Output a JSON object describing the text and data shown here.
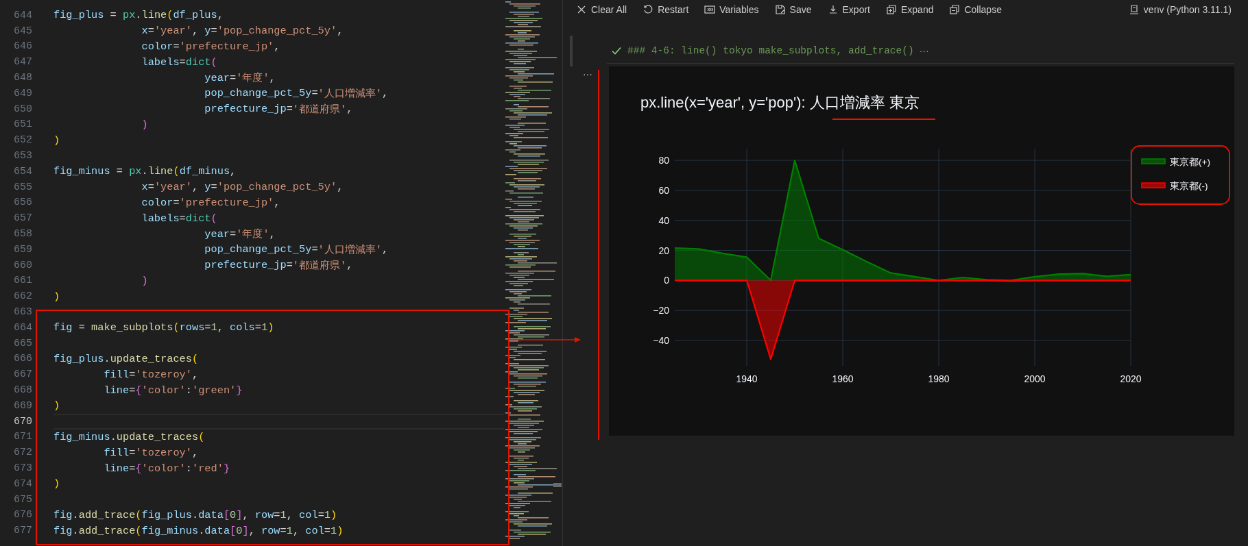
{
  "editor": {
    "lines": [
      {
        "number": "644",
        "current": false,
        "tokens": [
          {
            "kind": "var",
            "text": "fig_plus"
          },
          {
            "kind": "op",
            "text": " = "
          },
          {
            "kind": "mod",
            "text": "px"
          },
          {
            "kind": "op",
            "text": "."
          },
          {
            "kind": "fn",
            "text": "line"
          },
          {
            "kind": "b1",
            "text": "("
          },
          {
            "kind": "var",
            "text": "df_plus"
          },
          {
            "kind": "op",
            "text": ","
          }
        ]
      },
      {
        "number": "645",
        "current": false,
        "tokens": [
          {
            "kind": "var",
            "text": "              x"
          },
          {
            "kind": "op",
            "text": "="
          },
          {
            "kind": "str",
            "text": "'year'"
          },
          {
            "kind": "op",
            "text": ", "
          },
          {
            "kind": "var",
            "text": "y"
          },
          {
            "kind": "op",
            "text": "="
          },
          {
            "kind": "str",
            "text": "'pop_change_pct_5y'"
          },
          {
            "kind": "op",
            "text": ","
          }
        ]
      },
      {
        "number": "646",
        "current": false,
        "tokens": [
          {
            "kind": "var",
            "text": "              color"
          },
          {
            "kind": "op",
            "text": "="
          },
          {
            "kind": "str",
            "text": "'prefecture_jp'"
          },
          {
            "kind": "op",
            "text": ","
          }
        ]
      },
      {
        "number": "647",
        "current": false,
        "tokens": [
          {
            "kind": "var",
            "text": "              labels"
          },
          {
            "kind": "op",
            "text": "="
          },
          {
            "kind": "mod",
            "text": "dict"
          },
          {
            "kind": "b2",
            "text": "("
          }
        ]
      },
      {
        "number": "648",
        "current": false,
        "tokens": [
          {
            "kind": "var",
            "text": "                        year"
          },
          {
            "kind": "op",
            "text": "="
          },
          {
            "kind": "str",
            "text": "'年度'"
          },
          {
            "kind": "op",
            "text": ","
          }
        ]
      },
      {
        "number": "649",
        "current": false,
        "tokens": [
          {
            "kind": "var",
            "text": "                        pop_change_pct_5y"
          },
          {
            "kind": "op",
            "text": "="
          },
          {
            "kind": "str",
            "text": "'人口増減率'"
          },
          {
            "kind": "op",
            "text": ","
          }
        ]
      },
      {
        "number": "650",
        "current": false,
        "tokens": [
          {
            "kind": "var",
            "text": "                        prefecture_jp"
          },
          {
            "kind": "op",
            "text": "="
          },
          {
            "kind": "str",
            "text": "'都道府県'"
          },
          {
            "kind": "op",
            "text": ","
          }
        ]
      },
      {
        "number": "651",
        "current": false,
        "tokens": [
          {
            "kind": "b2",
            "text": "              )"
          }
        ]
      },
      {
        "number": "652",
        "current": false,
        "tokens": [
          {
            "kind": "b1",
            "text": ")"
          }
        ]
      },
      {
        "number": "653",
        "current": false
      },
      {
        "number": "654",
        "current": false,
        "tokens": [
          {
            "kind": "var",
            "text": "fig_minus"
          },
          {
            "kind": "op",
            "text": " = "
          },
          {
            "kind": "mod",
            "text": "px"
          },
          {
            "kind": "op",
            "text": "."
          },
          {
            "kind": "fn",
            "text": "line"
          },
          {
            "kind": "b1",
            "text": "("
          },
          {
            "kind": "var",
            "text": "df_minus"
          },
          {
            "kind": "op",
            "text": ","
          }
        ]
      },
      {
        "number": "655",
        "current": false,
        "tokens": [
          {
            "kind": "var",
            "text": "              x"
          },
          {
            "kind": "op",
            "text": "="
          },
          {
            "kind": "str",
            "text": "'year'"
          },
          {
            "kind": "op",
            "text": ", "
          },
          {
            "kind": "var",
            "text": "y"
          },
          {
            "kind": "op",
            "text": "="
          },
          {
            "kind": "str",
            "text": "'pop_change_pct_5y'"
          },
          {
            "kind": "op",
            "text": ","
          }
        ]
      },
      {
        "number": "656",
        "current": false,
        "tokens": [
          {
            "kind": "var",
            "text": "              color"
          },
          {
            "kind": "op",
            "text": "="
          },
          {
            "kind": "str",
            "text": "'prefecture_jp'"
          },
          {
            "kind": "op",
            "text": ","
          }
        ]
      },
      {
        "number": "657",
        "current": false,
        "tokens": [
          {
            "kind": "var",
            "text": "              labels"
          },
          {
            "kind": "op",
            "text": "="
          },
          {
            "kind": "mod",
            "text": "dict"
          },
          {
            "kind": "b2",
            "text": "("
          }
        ]
      },
      {
        "number": "658",
        "current": false,
        "tokens": [
          {
            "kind": "var",
            "text": "                        year"
          },
          {
            "kind": "op",
            "text": "="
          },
          {
            "kind": "str",
            "text": "'年度'"
          },
          {
            "kind": "op",
            "text": ","
          }
        ]
      },
      {
        "number": "659",
        "current": false,
        "tokens": [
          {
            "kind": "var",
            "text": "                        pop_change_pct_5y"
          },
          {
            "kind": "op",
            "text": "="
          },
          {
            "kind": "str",
            "text": "'人口増減率'"
          },
          {
            "kind": "op",
            "text": ","
          }
        ]
      },
      {
        "number": "660",
        "current": false,
        "tokens": [
          {
            "kind": "var",
            "text": "                        prefecture_jp"
          },
          {
            "kind": "op",
            "text": "="
          },
          {
            "kind": "str",
            "text": "'都道府県'"
          },
          {
            "kind": "op",
            "text": ","
          }
        ]
      },
      {
        "number": "661",
        "current": false,
        "tokens": [
          {
            "kind": "b2",
            "text": "              )"
          }
        ]
      },
      {
        "number": "662",
        "current": false,
        "tokens": [
          {
            "kind": "b1",
            "text": ")"
          }
        ]
      },
      {
        "number": "663",
        "current": false
      },
      {
        "number": "664",
        "current": false,
        "tokens": [
          {
            "kind": "var",
            "text": "fig"
          },
          {
            "kind": "op",
            "text": " = "
          },
          {
            "kind": "fn",
            "text": "make_subplots"
          },
          {
            "kind": "b1",
            "text": "("
          },
          {
            "kind": "var",
            "text": "rows"
          },
          {
            "kind": "op",
            "text": "="
          },
          {
            "kind": "num",
            "text": "1"
          },
          {
            "kind": "op",
            "text": ", "
          },
          {
            "kind": "var",
            "text": "cols"
          },
          {
            "kind": "op",
            "text": "="
          },
          {
            "kind": "num",
            "text": "1"
          },
          {
            "kind": "b1",
            "text": ")"
          }
        ]
      },
      {
        "number": "665",
        "current": false
      },
      {
        "number": "666",
        "current": false,
        "tokens": [
          {
            "kind": "var",
            "text": "fig_plus"
          },
          {
            "kind": "op",
            "text": "."
          },
          {
            "kind": "fn",
            "text": "update_traces"
          },
          {
            "kind": "b1",
            "text": "("
          }
        ]
      },
      {
        "number": "667",
        "current": false,
        "tokens": [
          {
            "kind": "var",
            "text": "        fill"
          },
          {
            "kind": "op",
            "text": "="
          },
          {
            "kind": "str",
            "text": "'tozeroy'"
          },
          {
            "kind": "op",
            "text": ","
          }
        ]
      },
      {
        "number": "668",
        "current": false,
        "tokens": [
          {
            "kind": "var",
            "text": "        line"
          },
          {
            "kind": "op",
            "text": "="
          },
          {
            "kind": "b2",
            "text": "{"
          },
          {
            "kind": "str",
            "text": "'color'"
          },
          {
            "kind": "op",
            "text": ":"
          },
          {
            "kind": "str",
            "text": "'green'"
          },
          {
            "kind": "b2",
            "text": "}"
          }
        ]
      },
      {
        "number": "669",
        "current": false,
        "tokens": [
          {
            "kind": "b1",
            "text": ")"
          }
        ]
      },
      {
        "number": "670",
        "current": true
      },
      {
        "number": "671",
        "current": false,
        "tokens": [
          {
            "kind": "var",
            "text": "fig_minus"
          },
          {
            "kind": "op",
            "text": "."
          },
          {
            "kind": "fn",
            "text": "update_traces"
          },
          {
            "kind": "b1",
            "text": "("
          }
        ]
      },
      {
        "number": "672",
        "current": false,
        "tokens": [
          {
            "kind": "var",
            "text": "        fill"
          },
          {
            "kind": "op",
            "text": "="
          },
          {
            "kind": "str",
            "text": "'tozeroy'"
          },
          {
            "kind": "op",
            "text": ","
          }
        ]
      },
      {
        "number": "673",
        "current": false,
        "tokens": [
          {
            "kind": "var",
            "text": "        line"
          },
          {
            "kind": "op",
            "text": "="
          },
          {
            "kind": "b2",
            "text": "{"
          },
          {
            "kind": "str",
            "text": "'color'"
          },
          {
            "kind": "op",
            "text": ":"
          },
          {
            "kind": "str",
            "text": "'red'"
          },
          {
            "kind": "b2",
            "text": "}"
          }
        ]
      },
      {
        "number": "674",
        "current": false,
        "tokens": [
          {
            "kind": "b1",
            "text": ")"
          }
        ]
      },
      {
        "number": "675",
        "current": false
      },
      {
        "number": "676",
        "current": false,
        "tokens": [
          {
            "kind": "var",
            "text": "fig"
          },
          {
            "kind": "op",
            "text": "."
          },
          {
            "kind": "fn",
            "text": "add_trace"
          },
          {
            "kind": "b1",
            "text": "("
          },
          {
            "kind": "var",
            "text": "fig_plus"
          },
          {
            "kind": "op",
            "text": "."
          },
          {
            "kind": "var",
            "text": "data"
          },
          {
            "kind": "b2",
            "text": "["
          },
          {
            "kind": "num",
            "text": "0"
          },
          {
            "kind": "b2",
            "text": "]"
          },
          {
            "kind": "op",
            "text": ", "
          },
          {
            "kind": "var",
            "text": "row"
          },
          {
            "kind": "op",
            "text": "="
          },
          {
            "kind": "num",
            "text": "1"
          },
          {
            "kind": "op",
            "text": ", "
          },
          {
            "kind": "var",
            "text": "col"
          },
          {
            "kind": "op",
            "text": "="
          },
          {
            "kind": "num",
            "text": "1"
          },
          {
            "kind": "b1",
            "text": ")"
          }
        ]
      },
      {
        "number": "677",
        "current": false,
        "tokens": [
          {
            "kind": "var",
            "text": "fig"
          },
          {
            "kind": "op",
            "text": "."
          },
          {
            "kind": "fn",
            "text": "add_trace"
          },
          {
            "kind": "b1",
            "text": "("
          },
          {
            "kind": "var",
            "text": "fig_minus"
          },
          {
            "kind": "op",
            "text": "."
          },
          {
            "kind": "var",
            "text": "data"
          },
          {
            "kind": "b2",
            "text": "["
          },
          {
            "kind": "num",
            "text": "0"
          },
          {
            "kind": "b2",
            "text": "]"
          },
          {
            "kind": "op",
            "text": ", "
          },
          {
            "kind": "var",
            "text": "row"
          },
          {
            "kind": "op",
            "text": "="
          },
          {
            "kind": "num",
            "text": "1"
          },
          {
            "kind": "op",
            "text": ", "
          },
          {
            "kind": "var",
            "text": "col"
          },
          {
            "kind": "op",
            "text": "="
          },
          {
            "kind": "num",
            "text": "1"
          },
          {
            "kind": "b1",
            "text": ")"
          }
        ]
      }
    ]
  },
  "toolbar": {
    "items": [
      {
        "kind": "clear",
        "label": "Clear All"
      },
      {
        "kind": "restart",
        "label": "Restart"
      },
      {
        "kind": "variables",
        "label": "Variables"
      },
      {
        "kind": "save",
        "label": "Save"
      },
      {
        "kind": "export",
        "label": "Export"
      },
      {
        "kind": "expand",
        "label": "Expand"
      },
      {
        "kind": "collapse",
        "label": "Collapse"
      }
    ],
    "kernel": {
      "label": "venv (Python 3.11.1)"
    }
  },
  "cell": {
    "success": true,
    "summary": "### 4-6: line() tokyo make_subplots, add_trace()",
    "more": "···"
  },
  "output": {
    "menu": "···",
    "chart_data": {
      "type": "area",
      "title": "px.line(x='year', y='pop'): 人口増減率 東京",
      "grid": true,
      "legend": true,
      "x": [
        1925,
        1930,
        1935,
        1940,
        1945,
        1950,
        1955,
        1960,
        1965,
        1970,
        1975,
        1980,
        1985,
        1990,
        1995,
        2000,
        2005,
        2010,
        2015,
        2020
      ],
      "series": [
        {
          "name": "東京都(+)",
          "color": "#008000",
          "values": [
            21.5,
            21,
            18,
            15.5,
            0,
            80,
            28,
            20.5,
            12.5,
            5,
            2.5,
            0,
            2,
            0.5,
            0,
            2.5,
            4.2,
            4.6,
            2.7,
            3.9
          ]
        },
        {
          "name": "東京都(-)",
          "color": "#ff0000",
          "values": [
            0,
            0,
            0,
            0,
            -52.5,
            0,
            0,
            0,
            0,
            0,
            0,
            -0.3,
            0,
            0,
            -0.5,
            0,
            0,
            0,
            0,
            0
          ]
        }
      ],
      "xlim": [
        1925,
        2020
      ],
      "ylim": [
        -56.9,
        87.8
      ],
      "xticks": [
        1940,
        1960,
        1980,
        2000,
        2020
      ],
      "yticks": [
        {
          "value": -40,
          "label": "−40"
        },
        {
          "value": -20,
          "label": "−20"
        },
        {
          "value": 0,
          "label": "0"
        },
        {
          "value": 20,
          "label": "20"
        },
        {
          "value": 40,
          "label": "40"
        },
        {
          "value": 60,
          "label": "60"
        },
        {
          "value": 80,
          "label": "80"
        }
      ]
    }
  }
}
